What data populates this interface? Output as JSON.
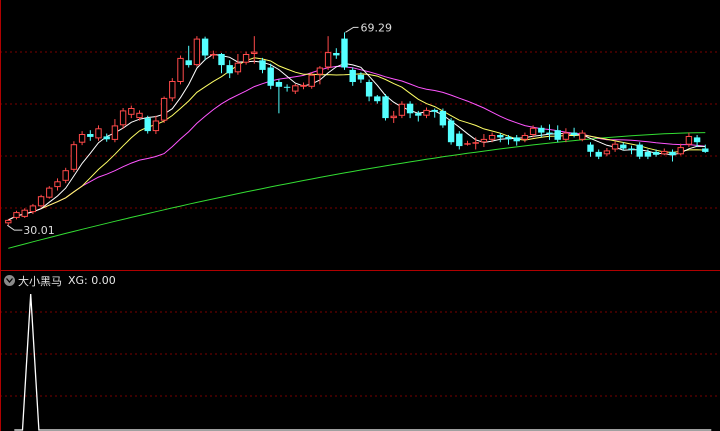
{
  "indicator": {
    "name": "大小黑马",
    "xg_label": "XG:",
    "xg_value": "0.00"
  },
  "chart_data": {
    "type": "candlestick",
    "price_range": [
      20,
      76
    ],
    "high_label": "69.29",
    "low_label": "30.01",
    "colors": {
      "up": "#ff4a4a",
      "down": "#54ffff",
      "ma5": "#ffffff",
      "ma10": "#ffff66",
      "ma20": "#ff55ff",
      "ma60": "#33dd33",
      "grid": "#7a0000",
      "indicator": "#ffffff"
    },
    "candles": [
      [
        29.7,
        30.4,
        29.3,
        30.6
      ],
      [
        30.8,
        32.0,
        30.5,
        32.3
      ],
      [
        31.0,
        32.5,
        30.8,
        32.8
      ],
      [
        32.0,
        33.4,
        31.6,
        33.7
      ],
      [
        33.2,
        35.3,
        33.0,
        35.6
      ],
      [
        35.0,
        37.1,
        34.8,
        37.4
      ],
      [
        37.2,
        38.4,
        36.5,
        39.0
      ],
      [
        38.5,
        40.7,
        38.0,
        41.2
      ],
      [
        40.8,
        46.1,
        40.3,
        46.7
      ],
      [
        46.4,
        48.2,
        45.9,
        48.8
      ],
      [
        48.2,
        47.6,
        46.8,
        49.0
      ],
      [
        47.3,
        49.4,
        46.8,
        50.0
      ],
      [
        47.7,
        47.1,
        46.6,
        48.3
      ],
      [
        47.0,
        50.0,
        46.5,
        51.3
      ],
      [
        50.0,
        53.1,
        49.3,
        53.6
      ],
      [
        52.2,
        53.6,
        51.5,
        54.1
      ],
      [
        51.5,
        52.6,
        51.0,
        53.1
      ],
      [
        51.5,
        48.8,
        48.3,
        52.0
      ],
      [
        48.8,
        51.0,
        48.2,
        52.0
      ],
      [
        51.0,
        55.7,
        50.5,
        56.0
      ],
      [
        55.6,
        59.2,
        55.0,
        59.8
      ],
      [
        59.0,
        64.0,
        58.5,
        64.5
      ],
      [
        63.5,
        62.5,
        62.0,
        66.5
      ],
      [
        62.5,
        68.0,
        62.2,
        68.5
      ],
      [
        68.0,
        64.5,
        63.5,
        68.4
      ],
      [
        64.5,
        64.8,
        63.8,
        65.5
      ],
      [
        64.8,
        62.5,
        60.8,
        65.0
      ],
      [
        62.5,
        60.8,
        59.8,
        63.5
      ],
      [
        61.0,
        63.0,
        60.5,
        64.8
      ],
      [
        63.0,
        64.8,
        62.6,
        65.3
      ],
      [
        64.8,
        65.3,
        62.8,
        68.5
      ],
      [
        63.5,
        61.5,
        60.8,
        64.0
      ],
      [
        62.0,
        58.2,
        57.5,
        62.8
      ],
      [
        59.0,
        58.0,
        52.5,
        59.5
      ],
      [
        58.0,
        57.8,
        57.0,
        58.5
      ],
      [
        57.0,
        58.3,
        56.5,
        58.6
      ],
      [
        58.0,
        58.4,
        57.5,
        58.9
      ],
      [
        58.0,
        60.5,
        57.6,
        61.0
      ],
      [
        60.5,
        62.0,
        58.5,
        62.3
      ],
      [
        62.0,
        65.2,
        61.5,
        68.5
      ],
      [
        65.0,
        64.5,
        63.8,
        66.0
      ],
      [
        68.0,
        62.0,
        61.5,
        69.29
      ],
      [
        61.5,
        59.0,
        58.2,
        62.0
      ],
      [
        60.5,
        59.5,
        58.8,
        61.0
      ],
      [
        59.0,
        56.0,
        55.0,
        59.5
      ],
      [
        56.0,
        55.0,
        54.5,
        56.3
      ],
      [
        56.0,
        51.5,
        51.0,
        56.5
      ],
      [
        51.5,
        52.0,
        50.5,
        53.0
      ],
      [
        52.0,
        54.5,
        51.5,
        55.0
      ],
      [
        54.5,
        52.5,
        51.5,
        55.0
      ],
      [
        52.5,
        52.0,
        50.8,
        53.0
      ],
      [
        52.0,
        53.2,
        51.5,
        53.7
      ],
      [
        53.2,
        52.8,
        51.6,
        53.5
      ],
      [
        53.0,
        50.0,
        49.5,
        53.5
      ],
      [
        51.0,
        46.5,
        46.0,
        51.5
      ],
      [
        48.3,
        45.7,
        45.0,
        48.8
      ],
      [
        46.0,
        46.3,
        45.8,
        46.8
      ],
      [
        46.5,
        46.5,
        45.0,
        47.5
      ],
      [
        46.5,
        47.2,
        45.5,
        48.2
      ],
      [
        47.0,
        48.0,
        46.5,
        48.5
      ],
      [
        48.0,
        47.5,
        46.5,
        48.4
      ],
      [
        47.6,
        47.1,
        46.0,
        48.0
      ],
      [
        47.5,
        46.7,
        45.8,
        48.0
      ],
      [
        47.0,
        48.0,
        46.5,
        48.5
      ],
      [
        48.0,
        49.5,
        47.5,
        50.0
      ],
      [
        49.5,
        48.5,
        47.6,
        50.0
      ],
      [
        48.5,
        48.2,
        47.0,
        50.2
      ],
      [
        49.0,
        47.0,
        46.5,
        50.0
      ],
      [
        47.0,
        48.5,
        46.5,
        49.4
      ],
      [
        48.5,
        48.0,
        47.5,
        49.5
      ],
      [
        47.0,
        48.5,
        46.7,
        49.0
      ],
      [
        46.0,
        44.5,
        43.5,
        46.5
      ],
      [
        44.5,
        43.5,
        43.0,
        45.0
      ],
      [
        44.0,
        44.8,
        43.6,
        45.3
      ],
      [
        45.0,
        46.2,
        44.5,
        46.7
      ],
      [
        46.0,
        45.2,
        44.8,
        46.5
      ],
      [
        45.2,
        44.9,
        44.0,
        45.8
      ],
      [
        46.0,
        43.5,
        43.0,
        46.5
      ],
      [
        44.5,
        43.5,
        43.0,
        45.0
      ],
      [
        44.5,
        43.9,
        43.5,
        45.0
      ],
      [
        44.0,
        44.7,
        43.8,
        45.2
      ],
      [
        44.5,
        43.8,
        42.5,
        45.0
      ],
      [
        44.0,
        45.5,
        43.8,
        46.2
      ],
      [
        46.0,
        47.8,
        45.5,
        48.5
      ],
      [
        47.5,
        46.5,
        45.5,
        48.0
      ],
      [
        45.2,
        44.5,
        44.3,
        46.0
      ]
    ],
    "ma60_end": 48.5,
    "indicator_series": {
      "name": "XG",
      "spike_index": 2,
      "max": 1
    }
  }
}
